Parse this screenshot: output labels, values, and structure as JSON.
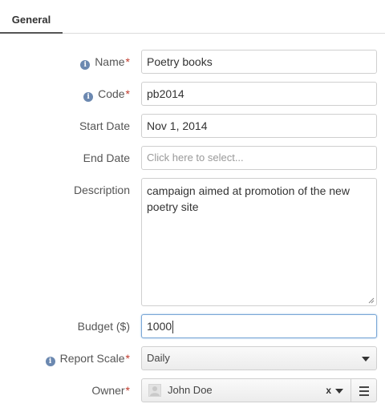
{
  "tabs": [
    {
      "label": "General",
      "active": true
    }
  ],
  "fields": {
    "name": {
      "label": "Name",
      "required": true,
      "info": true,
      "value": "Poetry books"
    },
    "code": {
      "label": "Code",
      "required": true,
      "info": true,
      "value": "pb2014"
    },
    "start_date": {
      "label": "Start Date",
      "value": "Nov 1, 2014"
    },
    "end_date": {
      "label": "End Date",
      "placeholder": "Click here to select..."
    },
    "description": {
      "label": "Description",
      "value": "campaign aimed at promotion of the new poetry site"
    },
    "budget": {
      "label": "Budget ($)",
      "value": "1000"
    },
    "report_scale": {
      "label": "Report Scale",
      "required": true,
      "info": true,
      "value": "Daily"
    },
    "owner": {
      "label": "Owner",
      "required": true,
      "value": "John Doe",
      "clear_label": "x"
    }
  },
  "icons": {
    "info": "info-circle",
    "required_mark": "*",
    "info_glyph": "i"
  },
  "colors": {
    "required": "#c0392b",
    "info_icon": "#6b88b0",
    "focus_border": "#7aa7d6"
  }
}
